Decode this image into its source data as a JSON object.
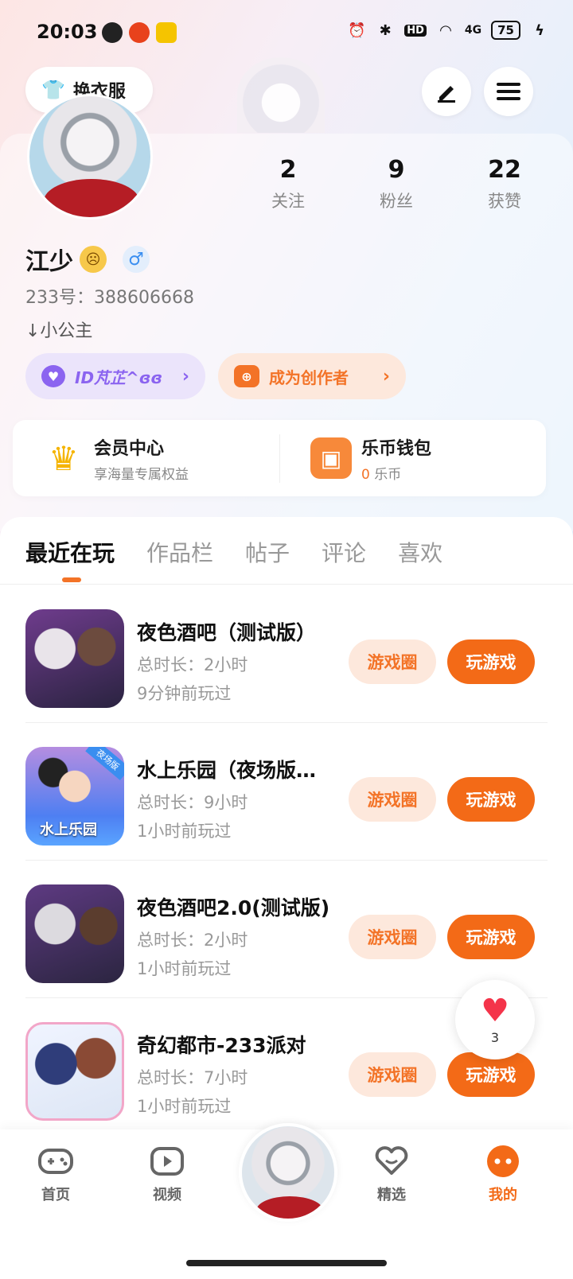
{
  "status_bar": {
    "time": "20:03",
    "battery": "75",
    "network": "4G",
    "hd": "HD"
  },
  "header": {
    "outfit_label": "换衣服"
  },
  "profile": {
    "stats": [
      {
        "value": "2",
        "label": "关注"
      },
      {
        "value": "9",
        "label": "粉丝"
      },
      {
        "value": "22",
        "label": "获赞"
      }
    ],
    "name": "江少",
    "gender_symbol": "♂",
    "uid": "233号：388606668",
    "signature": "↓小公主",
    "id_pill": "ID芃芷^ɞɞ",
    "creator_pill": "成为创作者"
  },
  "member": {
    "vip_title": "会员中心",
    "vip_sub": "享海量专属权益",
    "wallet_title": "乐币钱包",
    "wallet_amount": "0",
    "wallet_unit": "乐币"
  },
  "tabs": [
    "最近在玩",
    "作品栏",
    "帖子",
    "评论",
    "喜欢"
  ],
  "games": [
    {
      "title": "夜色酒吧（测试版）",
      "duration": "总时长：2小时",
      "last_played": "9分钟前玩过"
    },
    {
      "title": "水上乐园（夜场版…",
      "duration": "总时长：9小时",
      "last_played": "1小时前玩过",
      "icon_text": "水上乐园",
      "icon_tag": "夜场版"
    },
    {
      "title": "夜色酒吧2.0(测试版)",
      "duration": "总时长：2小时",
      "last_played": "1小时前玩过"
    },
    {
      "title": "奇幻都市-233派对",
      "duration": "总时长：7小时",
      "last_played": "1小时前玩过"
    }
  ],
  "buttons": {
    "game_circle": "游戏圈",
    "play": "玩游戏"
  },
  "like": {
    "count": "3"
  },
  "bottom_nav": [
    {
      "label": "首页"
    },
    {
      "label": "视频"
    },
    {
      "label": "精选"
    },
    {
      "label": "我的"
    }
  ],
  "colors": {
    "accent": "#f36a17",
    "purple": "#8b64f0",
    "heart": "#f4344a"
  }
}
